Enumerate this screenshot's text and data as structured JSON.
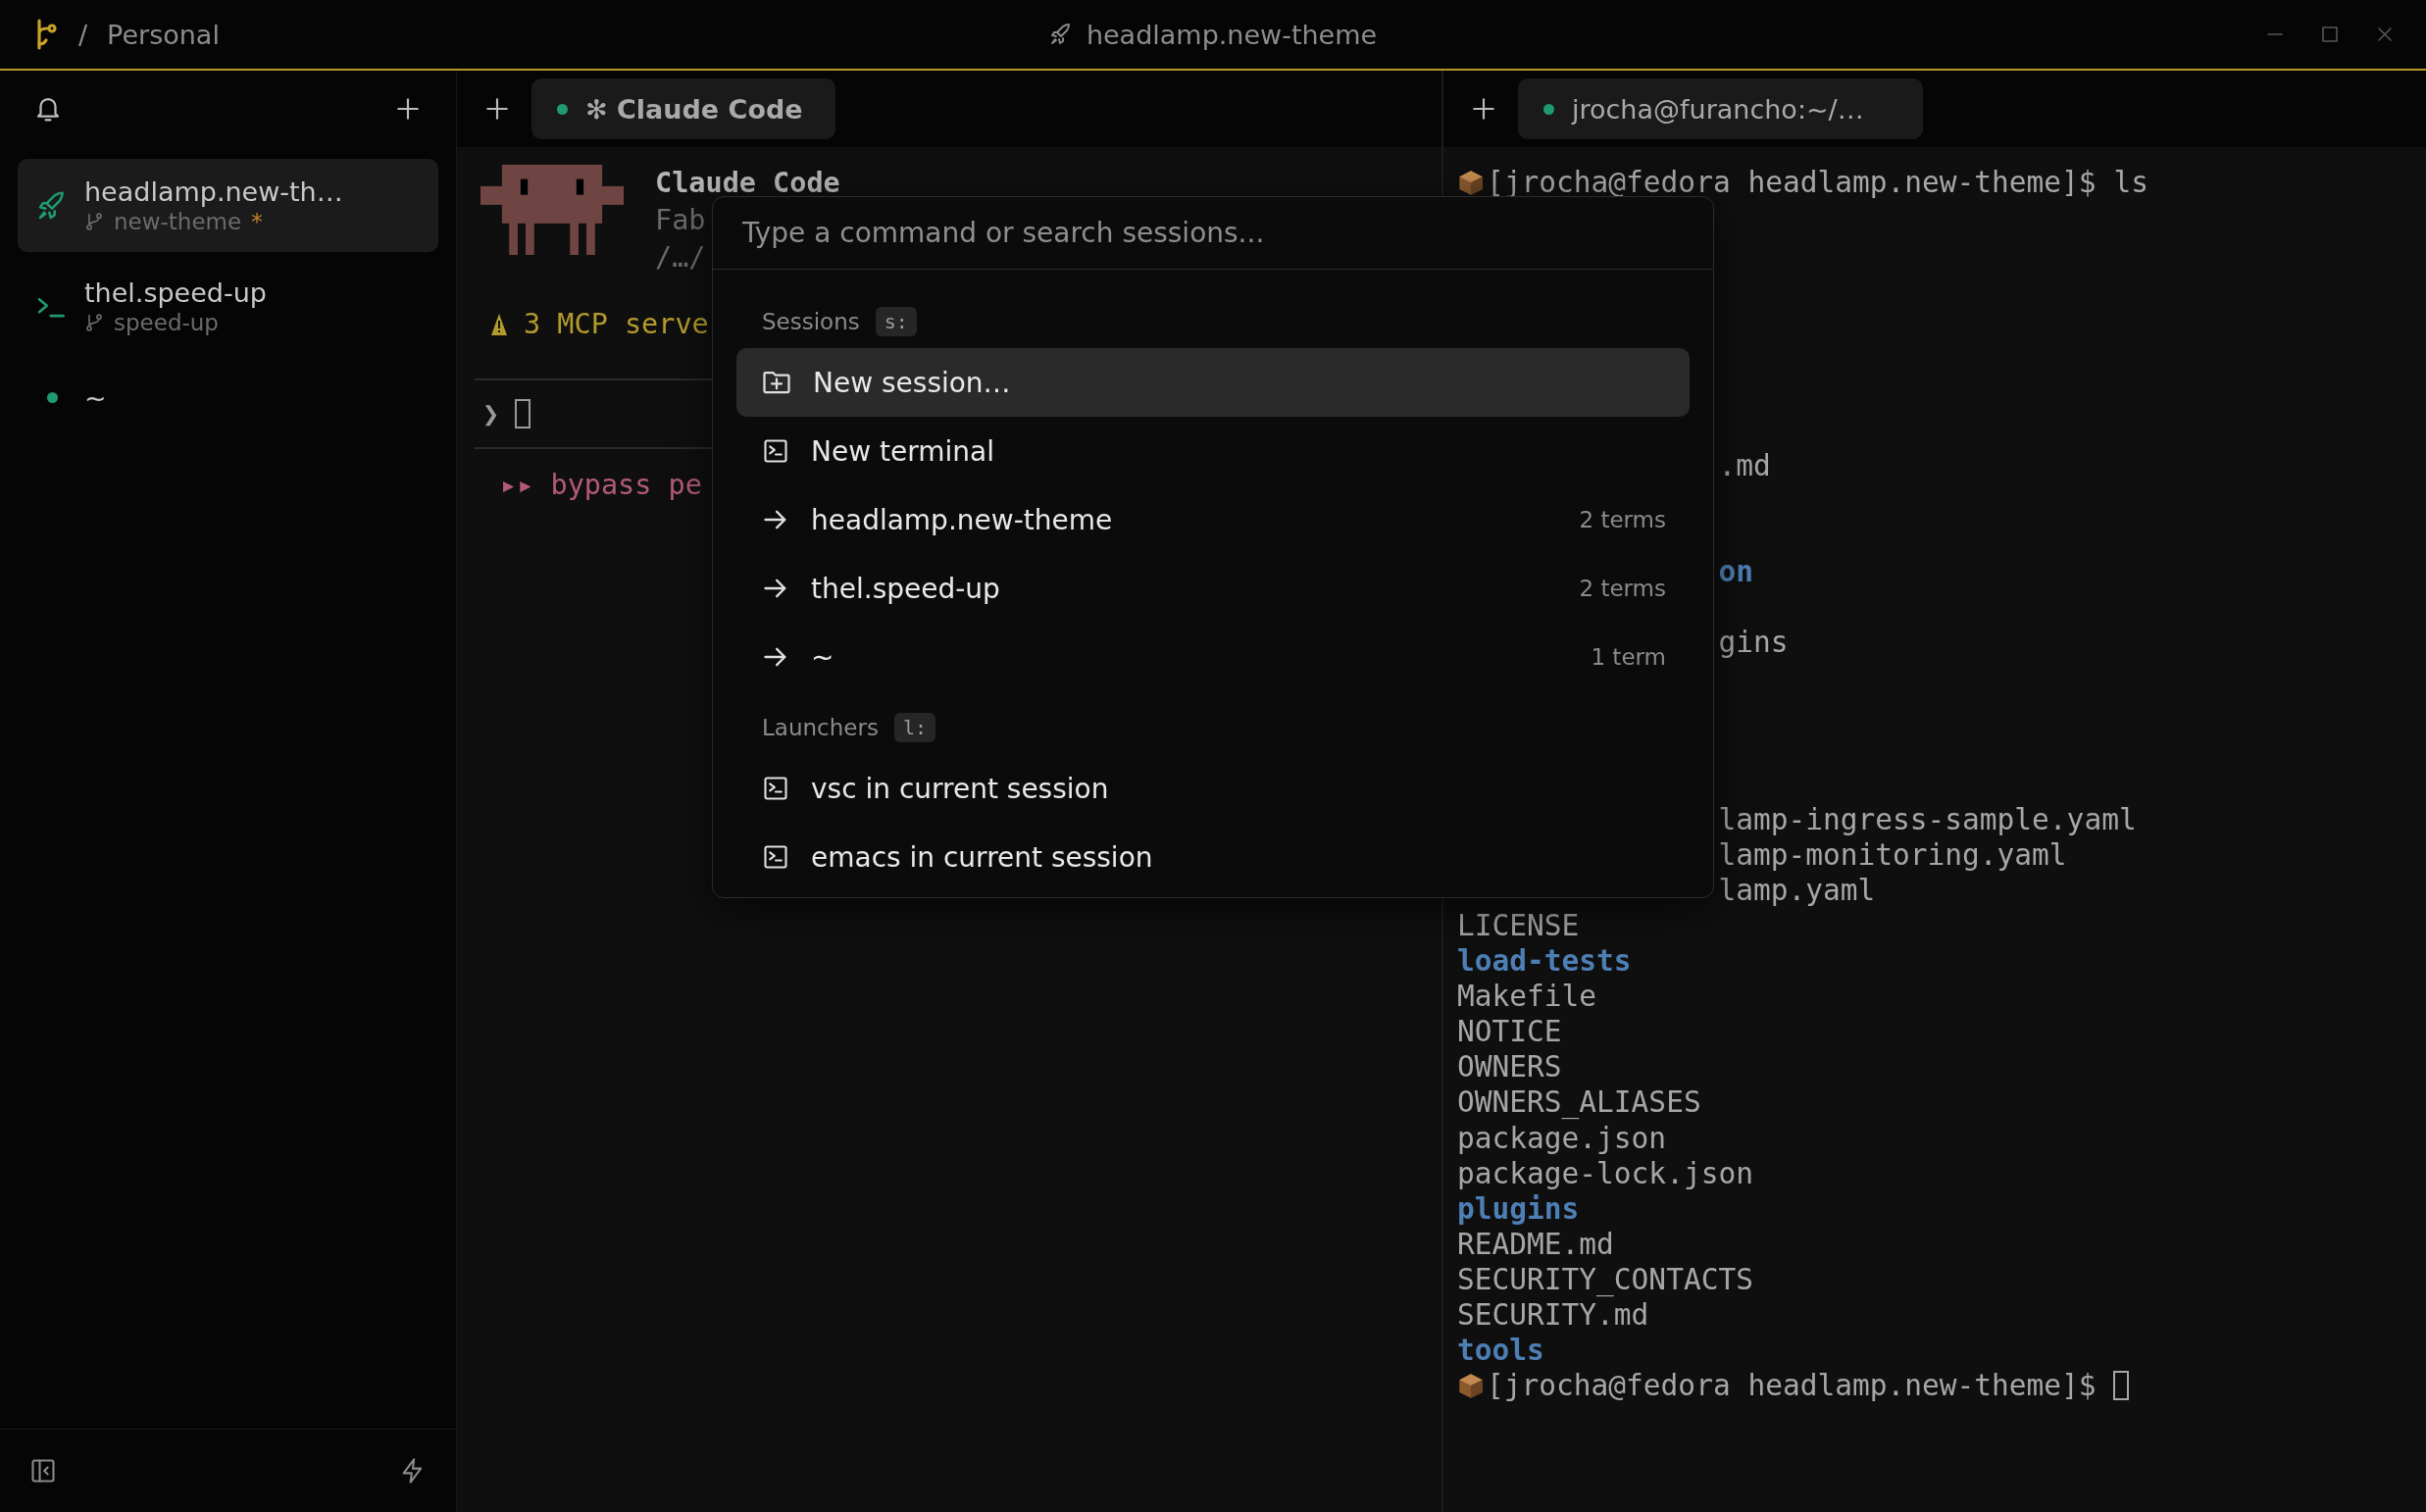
{
  "titlebar": {
    "separator": "/",
    "workspace": "Personal",
    "title": "headlamp.new-theme"
  },
  "sidebar": {
    "items": [
      {
        "kind": "rocket",
        "name": "headlamp.new-th…",
        "branch": "new-theme",
        "mark": "*",
        "selected": true
      },
      {
        "kind": "terminal",
        "name": "thel.speed-up",
        "branch": "speed-up",
        "selected": false
      },
      {
        "kind": "dot",
        "name": "~",
        "selected": false
      }
    ]
  },
  "left_pane": {
    "tab": {
      "label": "✻ Claude Code"
    },
    "terminal": {
      "title": "Claude Code",
      "lines": [
        "Fab",
        "/…/"
      ],
      "warning": "3 MCP serve",
      "prompt": "❯",
      "mode": "▸▸ bypass pe"
    }
  },
  "right_pane": {
    "tab": {
      "label": "jrocha@furancho:~/…"
    },
    "lines": [
      {
        "kind": "prompt",
        "text": "[jrocha@fedora headlamp.new-theme]$ ls",
        "cursor": false
      },
      {
        "kind": "hidden"
      },
      {
        "kind": "hidden"
      },
      {
        "kind": "hidden"
      },
      {
        "kind": "hidden"
      },
      {
        "kind": "hidden"
      },
      {
        "kind": "hidden"
      },
      {
        "kind": "hidden"
      },
      {
        "kind": "file",
        "text": ".md",
        "clipped": true
      },
      {
        "kind": "hidden"
      },
      {
        "kind": "hidden"
      },
      {
        "kind": "dir",
        "text": "on",
        "clipped": true
      },
      {
        "kind": "hidden"
      },
      {
        "kind": "file",
        "text": "gins",
        "clipped": true
      },
      {
        "kind": "hidden"
      },
      {
        "kind": "hidden"
      },
      {
        "kind": "hidden"
      },
      {
        "kind": "hidden"
      },
      {
        "kind": "file",
        "text": "lamp-ingress-sample.yaml",
        "clipped": true
      },
      {
        "kind": "file",
        "text": "lamp-monitoring.yaml",
        "clipped": true
      },
      {
        "kind": "file",
        "text": "lamp.yaml",
        "clipped": true
      },
      {
        "kind": "file",
        "text": "LICENSE",
        "clipped": false
      },
      {
        "kind": "dir",
        "text": "load-tests",
        "clipped": false
      },
      {
        "kind": "file",
        "text": "Makefile",
        "clipped": false
      },
      {
        "kind": "file",
        "text": "NOTICE",
        "clipped": false
      },
      {
        "kind": "file",
        "text": "OWNERS",
        "clipped": false
      },
      {
        "kind": "file",
        "text": "OWNERS_ALIASES",
        "clipped": false
      },
      {
        "kind": "file",
        "text": "package.json",
        "clipped": false
      },
      {
        "kind": "file",
        "text": "package-lock.json",
        "clipped": false
      },
      {
        "kind": "dir",
        "text": "plugins",
        "clipped": false
      },
      {
        "kind": "file",
        "text": "README.md",
        "clipped": false
      },
      {
        "kind": "file",
        "text": "SECURITY_CONTACTS",
        "clipped": false
      },
      {
        "kind": "file",
        "text": "SECURITY.md",
        "clipped": false
      },
      {
        "kind": "dir",
        "text": "tools",
        "clipped": false
      },
      {
        "kind": "prompt",
        "text": "[jrocha@fedora headlamp.new-theme]$ ",
        "cursor": true
      }
    ]
  },
  "palette": {
    "placeholder": "Type a command or search sessions...",
    "sections": [
      {
        "title": "Sessions",
        "shortcut": "s:",
        "items": [
          {
            "kind": "new-session",
            "label": "New session…",
            "selected": true
          },
          {
            "kind": "terminal",
            "label": "New terminal",
            "selected": false
          },
          {
            "kind": "goto",
            "label": "headlamp.new-theme",
            "count": "2 terms",
            "selected": false
          },
          {
            "kind": "goto",
            "label": "thel.speed-up",
            "count": "2 terms",
            "selected": false
          },
          {
            "kind": "goto",
            "label": "~",
            "count": "1 term",
            "selected": false
          }
        ]
      },
      {
        "title": "Launchers",
        "shortcut": "l:",
        "items": [
          {
            "kind": "terminal",
            "label": "vsc in current session",
            "selected": false
          },
          {
            "kind": "terminal",
            "label": "emacs in current session",
            "selected": false
          }
        ]
      }
    ]
  }
}
